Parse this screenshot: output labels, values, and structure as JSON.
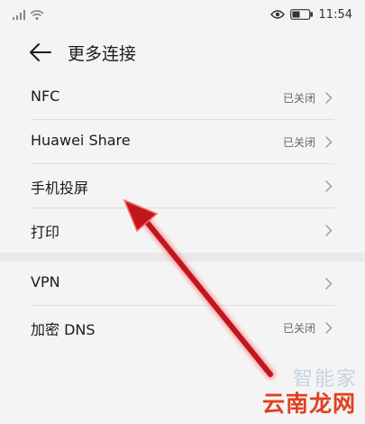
{
  "status_bar": {
    "time": "11:54",
    "icons": [
      "signal-icon",
      "wifi-icon",
      "eye-icon",
      "battery-icon"
    ]
  },
  "header": {
    "title": "更多连接",
    "back_icon": "back-arrow-icon"
  },
  "rows": [
    {
      "label": "NFC",
      "status": "已关闭"
    },
    {
      "label": "Huawei Share",
      "status": "已关闭"
    },
    {
      "label": "手机投屏",
      "status": ""
    },
    {
      "label": "打印",
      "status": ""
    },
    {
      "label": "VPN",
      "status": ""
    },
    {
      "label": "加密 DNS",
      "status": "已关闭"
    }
  ],
  "watermark": {
    "logo": "智能家",
    "site": "云南龙网"
  },
  "colors": {
    "background": "#f4f4f4",
    "annotation_arrow": "#c0161d",
    "watermark_site": "#e04020"
  }
}
